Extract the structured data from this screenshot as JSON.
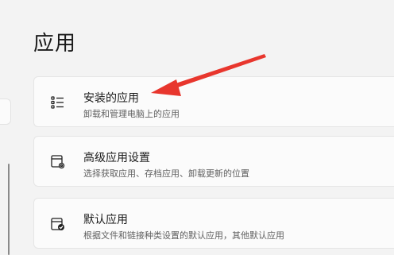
{
  "page": {
    "title": "应用"
  },
  "cards": [
    {
      "title": "安装的应用",
      "subtitle": "卸载和管理电脑上的应用",
      "icon": "apps-list-icon"
    },
    {
      "title": "高级应用设置",
      "subtitle": "选择获取应用、存档应用、卸载更新的位置",
      "icon": "advanced-app-settings-icon"
    },
    {
      "title": "默认应用",
      "subtitle": "根据文件和链接种类设置的默认应用，其他默认应用",
      "icon": "default-apps-icon"
    }
  ],
  "annotation": {
    "arrow_color": "#e8362d"
  }
}
